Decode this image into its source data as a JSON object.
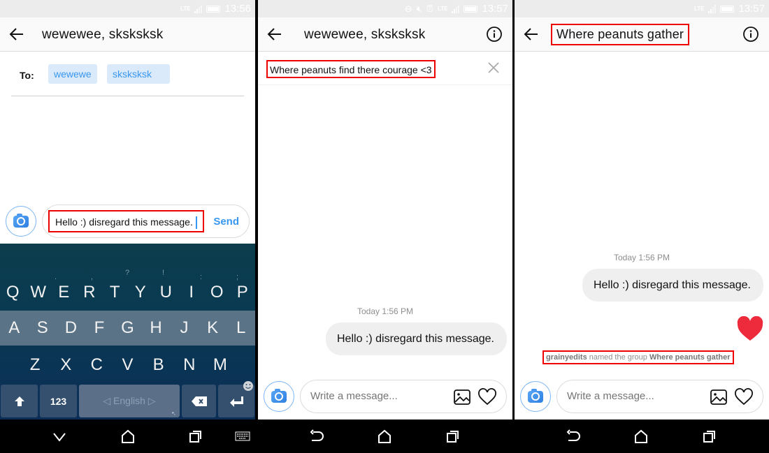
{
  "panels": [
    {
      "status": {
        "time": "13:56",
        "network": "LTE",
        "icons": [
          "lte-icon",
          "signal-icon",
          "battery-icon"
        ]
      },
      "header": {
        "title": "wewewee, sksksksk",
        "back_icon": "arrow-left-icon"
      },
      "recipients": {
        "label": "To:",
        "chips": [
          "wewewe",
          "sksksksk"
        ]
      },
      "composer": {
        "value": "Hello :) disregard this message.",
        "send_label": "Send",
        "camera_icon": "camera-icon"
      },
      "keyboard": {
        "hints": [
          ".",
          ",",
          "?",
          "!",
          ":",
          ";"
        ],
        "row1": [
          "Q",
          "W",
          "E",
          "R",
          "T",
          "Y",
          "U",
          "I",
          "O",
          "P"
        ],
        "row2": [
          "A",
          "S",
          "D",
          "F",
          "G",
          "H",
          "J",
          "K",
          "L"
        ],
        "row3": [
          "Z",
          "X",
          "C",
          "V",
          "B",
          "N",
          "M"
        ],
        "shift_icon": "shift-arrow-icon",
        "numbers_label": "123",
        "space_label": "◁ English ▷",
        "space_hint": "•,",
        "backspace_icon": "backspace-icon",
        "enter_icon": "enter-icon",
        "emoji_icon": "smiley-icon"
      },
      "navbar": [
        "chevron-down-icon",
        "home-icon",
        "recents-icon",
        "keyboard-icon"
      ]
    },
    {
      "status": {
        "time": "13:57",
        "network": "LTE",
        "icons": [
          "do-not-disturb-icon",
          "mute-icon",
          "alarm-icon",
          "lte-icon",
          "signal-icon",
          "battery-icon"
        ]
      },
      "header": {
        "title": "wewewee, sksksksk",
        "back_icon": "arrow-left-icon",
        "info_icon": "info-icon"
      },
      "group_name_field": {
        "value": "Where peanuts find there courage <3",
        "clear_icon": "close-icon"
      },
      "messages": {
        "timestamp": "Today 1:56 PM",
        "bubbles": [
          "Hello :) disregard this message."
        ]
      },
      "composer": {
        "placeholder": "Write a message...",
        "camera_icon": "camera-icon",
        "gallery_icon": "image-icon",
        "like_icon": "heart-outline-icon"
      },
      "navbar": [
        "back-icon",
        "home-icon",
        "recents-icon"
      ]
    },
    {
      "status": {
        "time": "13:57",
        "network": "LTE",
        "icons": [
          "lte-icon",
          "signal-icon",
          "battery-icon"
        ]
      },
      "header": {
        "title": "Where peanuts gather",
        "back_icon": "arrow-left-icon",
        "info_icon": "info-icon"
      },
      "messages": {
        "timestamp": "Today 1:56 PM",
        "bubbles": [
          "Hello :) disregard this message."
        ],
        "reaction": "heart-filled-icon",
        "event": {
          "actor": "grainyedits",
          "action": " named the group ",
          "target": "Where peanuts gather"
        }
      },
      "composer": {
        "placeholder": "Write a message...",
        "camera_icon": "camera-icon",
        "gallery_icon": "image-icon",
        "like_icon": "heart-outline-icon"
      },
      "navbar": [
        "back-icon",
        "home-icon",
        "recents-icon"
      ]
    }
  ],
  "colors": {
    "accent": "#3897f0",
    "highlight": "#e00000",
    "heart": "#ed2b3c",
    "bubble": "#efefef",
    "chip_bg": "#dbeafb"
  }
}
